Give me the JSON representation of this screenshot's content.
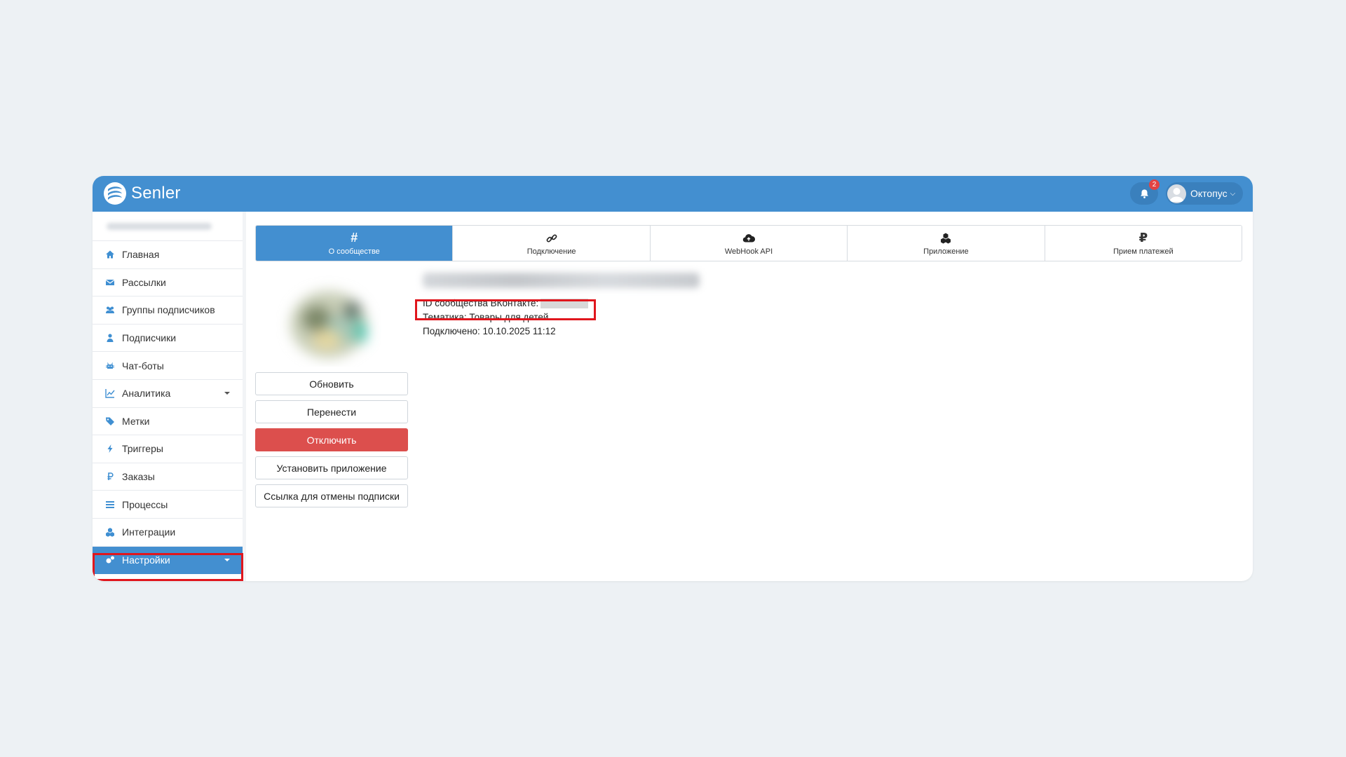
{
  "app": {
    "brand": "Senler",
    "notifications_count": "2",
    "user_name": "Октопус"
  },
  "sidebar": {
    "items": [
      {
        "label": "Главная",
        "icon": "home-icon"
      },
      {
        "label": "Рассылки",
        "icon": "envelope-icon"
      },
      {
        "label": "Группы подписчиков",
        "icon": "users-icon"
      },
      {
        "label": "Подписчики",
        "icon": "user-icon"
      },
      {
        "label": "Чат-боты",
        "icon": "robot-icon"
      },
      {
        "label": "Аналитика",
        "icon": "chart-line-icon"
      },
      {
        "label": "Метки",
        "icon": "tag-icon"
      },
      {
        "label": "Триггеры",
        "icon": "bolt-icon"
      },
      {
        "label": "Заказы",
        "icon": "ruble-icon"
      },
      {
        "label": "Процессы",
        "icon": "list-icon"
      },
      {
        "label": "Интеграции",
        "icon": "cubes-icon"
      },
      {
        "label": "Настройки",
        "icon": "cogs-icon"
      }
    ]
  },
  "tabs": [
    {
      "label": "О сообществе",
      "icon": "hash-icon",
      "glyph": "#"
    },
    {
      "label": "Подключение",
      "icon": "link-icon"
    },
    {
      "label": "WebHook API",
      "icon": "cloud-upload-icon"
    },
    {
      "label": "Приложение",
      "icon": "cubes-icon"
    },
    {
      "label": "Прием платежей",
      "icon": "ruble-icon",
      "glyph": "₽"
    }
  ],
  "community": {
    "id_label": "ID сообщества ВКонтакте:",
    "topic": "Тематика: Товары для детей",
    "connected": "Подключено: 10.10.2025 11:12"
  },
  "actions": {
    "refresh": "Обновить",
    "transfer": "Перенести",
    "disconnect": "Отключить",
    "install_app": "Установить приложение",
    "unsubscribe_link": "Ссылка для отмены подписки"
  },
  "colors": {
    "primary": "#438fd0",
    "danger": "#dc4f4d",
    "highlight": "#e0161d",
    "background": "#edf1f4"
  }
}
